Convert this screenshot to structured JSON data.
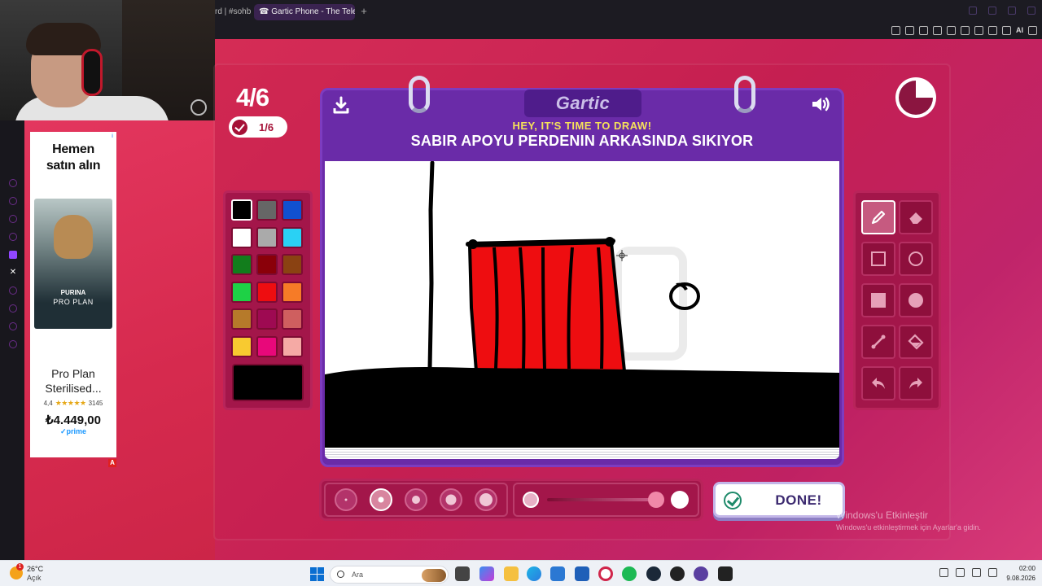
{
  "browser": {
    "tab_prev": "rd | #sohb",
    "tab_active": "☎ Gartic Phone - The Telephc",
    "tab_plus": "+",
    "ai_label": "AI"
  },
  "ad": {
    "title_line1": "Hemen",
    "title_line2": "satın alın",
    "brand": "PURINA",
    "brand2": "PRO PLAN",
    "product_name": "Pro Plan Sterilised...",
    "rating": "4,4",
    "stars": "★★★★★",
    "reviews": "3145",
    "price": "₺4.449,00",
    "prime": "✓prime",
    "ad_marker": "A",
    "info": "i"
  },
  "game": {
    "round": "4/6",
    "done_count": "1/6",
    "logo": "Gartic",
    "prompt_sub": "HEY, IT'S TIME TO DRAW!",
    "prompt": "SABIR APOYU PERDENIN ARKASINDA SIKIYOR",
    "done_button": "DONE!",
    "timer_remaining_fraction": 0.75,
    "selected_color": "#000000",
    "palette": [
      "#000000",
      "#666666",
      "#1050d0",
      "#ffffff",
      "#aaaaaa",
      "#2ad1f4",
      "#127d1c",
      "#8a0009",
      "#8a4212",
      "#1ed146",
      "#ee0d10",
      "#f67b27",
      "#b67a2a",
      "#9e0a52",
      "#cf5f5f",
      "#f8ca30",
      "#e8087a",
      "#f5aaa5"
    ],
    "tools": [
      "pencil-tool",
      "eraser-tool",
      "rectangle-tool",
      "ellipse-tool",
      "filled-rectangle-tool",
      "filled-ellipse-tool",
      "line-tool",
      "fill-bucket-tool",
      "undo-tool",
      "redo-tool"
    ],
    "selected_tool": "pencil-tool",
    "selected_brush_size_index": 1
  },
  "windows": {
    "activate_title": "Windows'u Etkinleştir",
    "activate_sub": "Windows'u etkinleştirmek için Ayarlar'a gidin."
  },
  "taskbar": {
    "temp": "26°C",
    "weather": "Açık",
    "weather_badge": "1",
    "search_placeholder": "Ara",
    "time": "02:00",
    "date": "9.08.2026"
  }
}
